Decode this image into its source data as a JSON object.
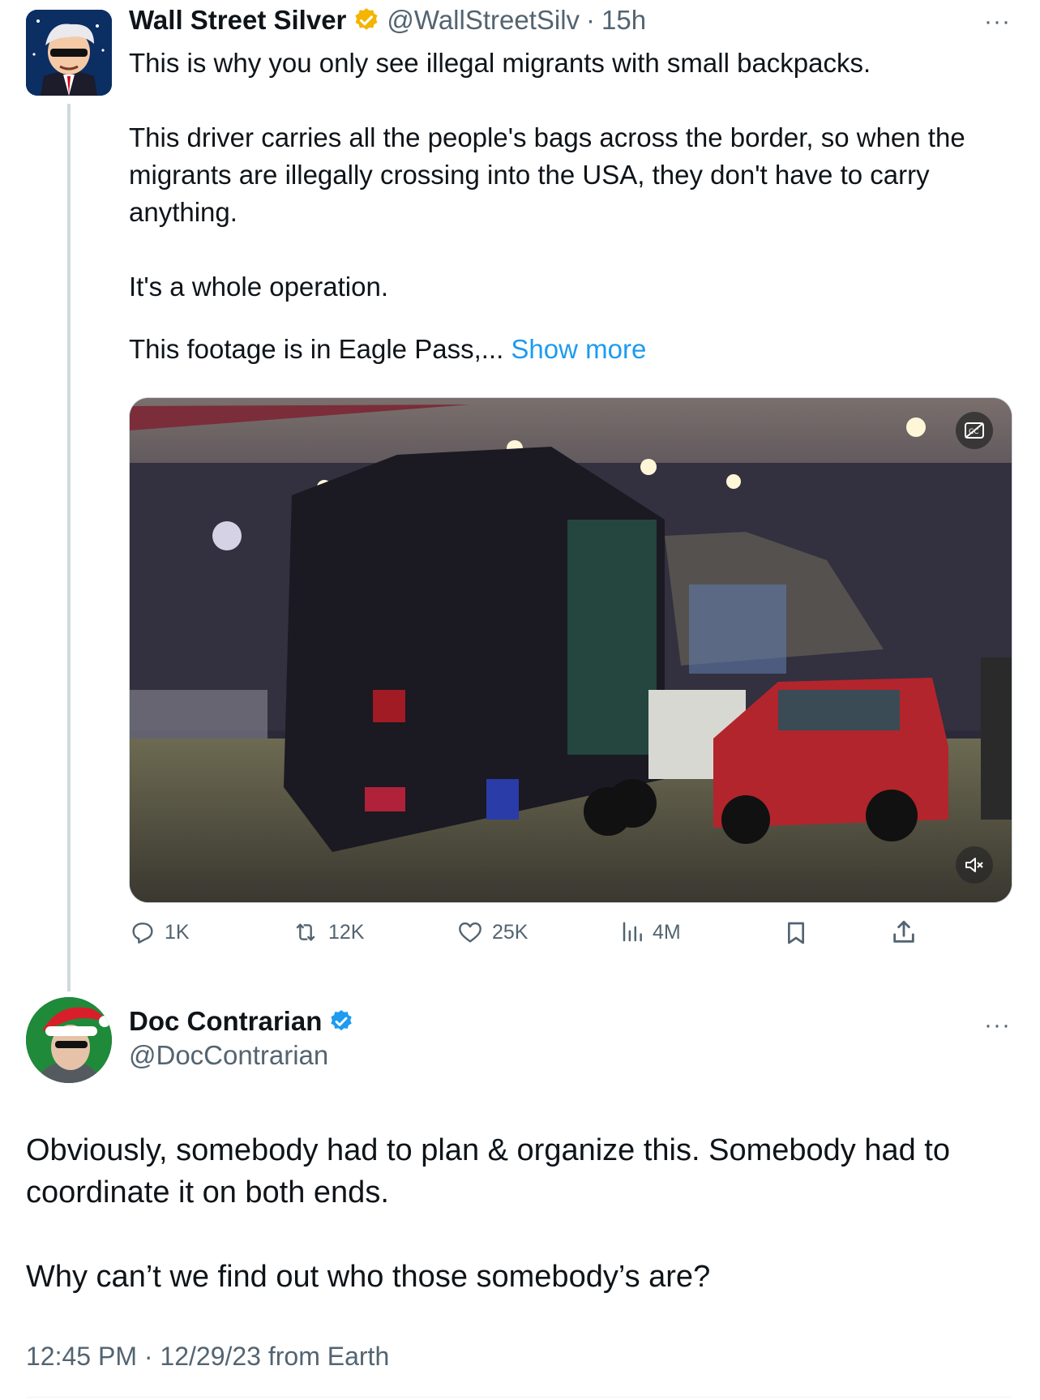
{
  "tweet": {
    "author_name": "Wall Street Silver",
    "author_handle": "@WallStreetSilv",
    "separator": "·",
    "time_ago": "15h",
    "more_label": "···",
    "paragraphs": [
      "This is why you only see illegal migrants with small backpacks.",
      "This driver carries all the people's bags across the border, so when the migrants are illegally crossing into the USA, they don't have to carry anything.",
      "It's a whole operation."
    ],
    "last_paragraph": "This footage is in Eagle Pass,...",
    "show_more": "Show more",
    "verified_badge_color": "#f4b400",
    "media_icons": [
      "captions-off-icon",
      "muted-icon"
    ],
    "actions": {
      "replies": "1K",
      "reposts": "12K",
      "likes": "25K",
      "views": "4M"
    }
  },
  "reply": {
    "author_name": "Doc Contrarian",
    "author_handle": "@DocContrarian",
    "more_label": "···",
    "verified_badge_color": "#1d9bf0",
    "paragraphs": [
      "Obviously, somebody had to plan & organize this. Somebody had to coordinate it on both ends.",
      "Why can’t we find out who those somebody’s are?"
    ],
    "timestamp": "12:45 PM · 12/29/23 from Earth"
  }
}
